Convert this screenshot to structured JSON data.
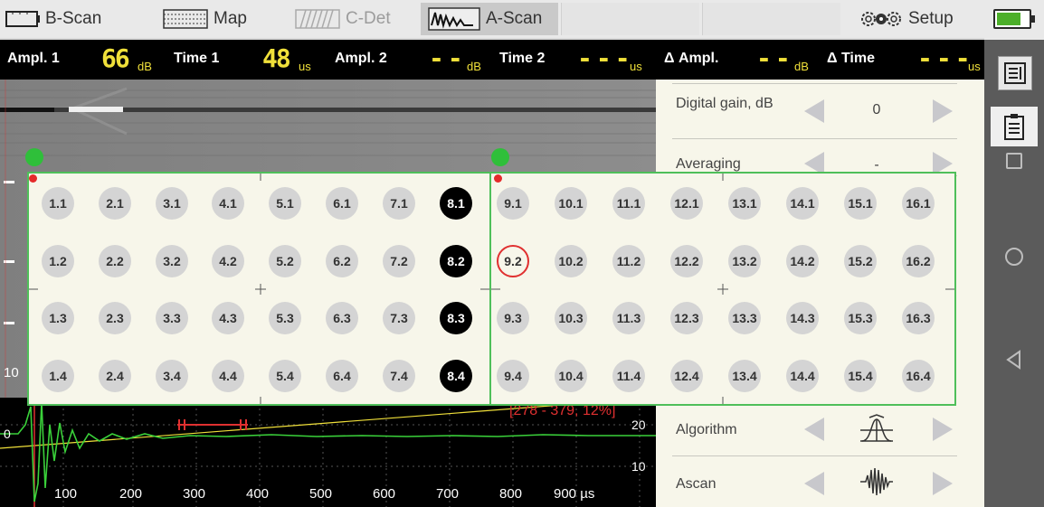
{
  "tabs": [
    {
      "label": "B-Scan",
      "icon": "bscan-icon"
    },
    {
      "label": "Map",
      "icon": "map-grid-icon"
    },
    {
      "label": "C-Det",
      "icon": "cdet-icon"
    },
    {
      "label": "A-Scan",
      "icon": "ascan-icon"
    },
    {
      "label": "Setup",
      "icon": "gears-icon"
    }
  ],
  "measurements": [
    {
      "label": "Ampl. 1",
      "value": "66",
      "unit": "dB"
    },
    {
      "label": "Time 1",
      "value": "48",
      "unit": "us"
    },
    {
      "label": "Ampl. 2",
      "value": "--",
      "unit": "dB"
    },
    {
      "label": "Time 2",
      "value": "---",
      "unit": "us"
    },
    {
      "label": "Δ Ampl.",
      "value": "--",
      "unit": "dB"
    },
    {
      "label": "Δ Time",
      "value": "---",
      "unit": "us"
    }
  ],
  "panel": {
    "digital_gain": {
      "label": "Digital gain, dB",
      "value": "0"
    },
    "averaging": {
      "label": "Averaging",
      "value": "-"
    },
    "algorithm": {
      "label": "Algorithm",
      "icon": "algorithm-icon"
    },
    "ascan": {
      "label": "Ascan",
      "icon": "waveform-icon"
    }
  },
  "left_grid": {
    "rows": [
      [
        "1.1",
        "2.1",
        "3.1",
        "4.1",
        "5.1",
        "6.1",
        "7.1",
        "8.1"
      ],
      [
        "1.2",
        "2.2",
        "3.2",
        "4.2",
        "5.2",
        "6.2",
        "7.2",
        "8.2"
      ],
      [
        "1.3",
        "2.3",
        "3.3",
        "4.3",
        "5.3",
        "6.3",
        "7.3",
        "8.3"
      ],
      [
        "1.4",
        "2.4",
        "3.4",
        "4.4",
        "5.4",
        "6.4",
        "7.4",
        "8.4"
      ]
    ],
    "selected_column": "8"
  },
  "right_grid": {
    "rows": [
      [
        "9.1",
        "10.1",
        "11.1",
        "12.1",
        "13.1",
        "14.1",
        "15.1",
        "16.1"
      ],
      [
        "9.2",
        "10.2",
        "11.2",
        "12.2",
        "13.2",
        "14.2",
        "15.2",
        "16.2"
      ],
      [
        "9.3",
        "10.3",
        "11.3",
        "12.3",
        "13.3",
        "14.3",
        "15.3",
        "16.3"
      ],
      [
        "9.4",
        "10.4",
        "11.4",
        "12.4",
        "13.4",
        "14.4",
        "15.4",
        "16.4"
      ]
    ],
    "focused": "9.2"
  },
  "ascan": {
    "x_ticks": [
      "100",
      "200",
      "300",
      "400",
      "500",
      "600",
      "700",
      "800",
      "900 µs"
    ],
    "y_ticks": [
      "20",
      "10"
    ],
    "gate_readout": "[278 - 379, 12%]",
    "scan_y_label": "10",
    "zero_label": "0",
    "colors": {
      "trace": "#3ad13a",
      "gate": "#e03030",
      "threshold": "#f0e03a",
      "readout": "#e03030"
    }
  },
  "colors": {
    "accent_green": "#4fbf5a",
    "value_yellow": "#f0e03a",
    "panel_bg": "#f7f6ea"
  }
}
